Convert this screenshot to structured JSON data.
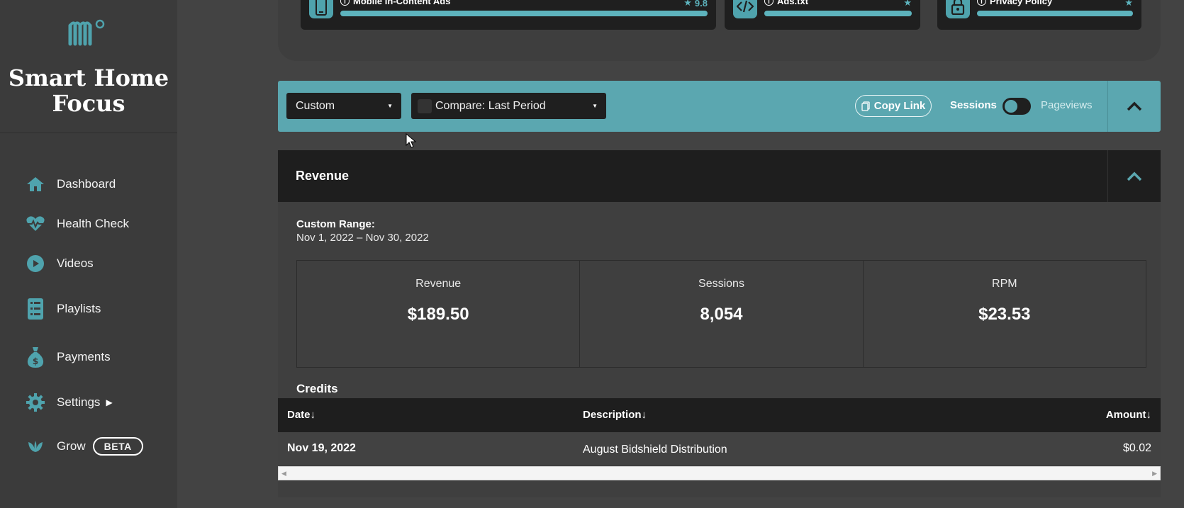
{
  "brand": {
    "site_name": "Smart Home Focus",
    "logo_icon": "brand-logo-icon",
    "accent": "#4fa3ad"
  },
  "nav": {
    "items": [
      {
        "label": "Dashboard",
        "icon": "home-icon"
      },
      {
        "label": "Health Check",
        "icon": "heartbeat-icon"
      },
      {
        "label": "Videos",
        "icon": "play-circle-icon"
      },
      {
        "label": "Playlists",
        "icon": "list-icon"
      },
      {
        "label": "Payments",
        "icon": "money-bag-icon"
      },
      {
        "label": "Settings",
        "icon": "gear-icon"
      },
      {
        "label": "Grow",
        "icon": "leaf-icon",
        "badge": "BETA"
      }
    ]
  },
  "health_cards": [
    {
      "title": "Mobile In-Content Ads",
      "score": "9.8",
      "icon": "mobile-icon"
    },
    {
      "title": "Ads.txt",
      "score": "",
      "icon": "code-icon"
    },
    {
      "title": "Privacy Policy",
      "score": "",
      "icon": "lock-icon"
    }
  ],
  "filters": {
    "range_select": "Custom",
    "compare_select": "Compare: Last Period",
    "copy_link": "Copy Link",
    "toggle_left": "Sessions",
    "toggle_right": "Pageviews"
  },
  "revenue": {
    "title": "Revenue",
    "range_label": "Custom Range:",
    "range_value": "Nov 1, 2022 – Nov 30, 2022",
    "stats": [
      {
        "label": "Revenue",
        "value": "$189.50"
      },
      {
        "label": "Sessions",
        "value": "8,054"
      },
      {
        "label": "RPM",
        "value": "$23.53"
      }
    ]
  },
  "credits": {
    "title": "Credits",
    "columns": [
      "Date↓",
      "Description↓",
      "Amount↓"
    ],
    "rows": [
      {
        "date": "Nov 19, 2022",
        "description": "August Bidshield Distribution",
        "amount": "$0.02"
      }
    ]
  }
}
